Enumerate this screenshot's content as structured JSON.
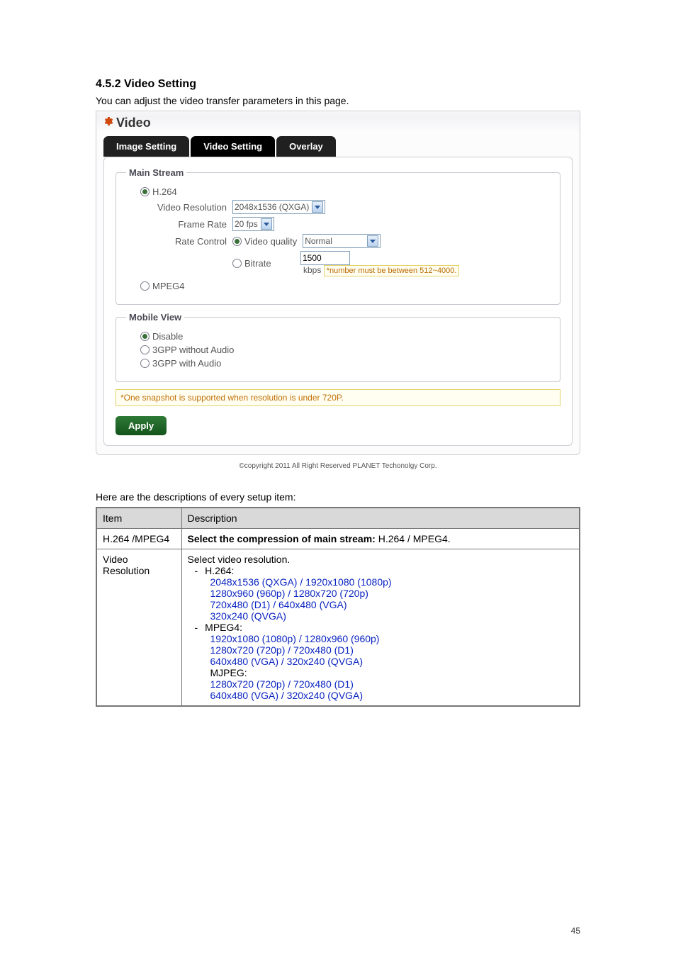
{
  "section": {
    "number": "4.5.2",
    "title": "4.5.2 Video Setting",
    "intro": "You can adjust the video transfer parameters in this page."
  },
  "video_header": "Video",
  "tabs": {
    "image": "Image Setting",
    "video": "Video Setting",
    "overlay": "Overlay"
  },
  "main_stream": {
    "legend": "Main Stream",
    "h264": "H.264",
    "video_resolution_label": "Video Resolution",
    "video_resolution_value": "2048x1536 (QXGA)",
    "frame_rate_label": "Frame Rate",
    "frame_rate_value": "20 fps",
    "rate_control_label": "Rate Control",
    "video_quality_label": "Video quality",
    "video_quality_value": "Normal",
    "bitrate_label": "Bitrate",
    "bitrate_value": "1500",
    "kbps": "kbps",
    "bitrate_note": "*number must be between 512~4000.",
    "mpeg4": "MPEG4"
  },
  "mobile_view": {
    "legend": "Mobile View",
    "disable": "Disable",
    "gpp_no_audio": "3GPP without Audio",
    "gpp_audio": "3GPP with Audio"
  },
  "snapshot_note": "*One snapshot is supported when resolution is under 720P.",
  "apply": "Apply",
  "copyright": "©copyright 2011 All Right Reserved PLANET Techonolgy Corp.",
  "desc_intro": "Here are the descriptions of every setup item:",
  "table": {
    "h_item": "Item",
    "h_desc": "Description",
    "r1_item": "H.264 /MPEG4",
    "r1_desc_prefix": "Select the compression of main stream: ",
    "r1_desc_suffix": "H.264 / MPEG4.",
    "r2_item_a": "Video",
    "r2_item_b": "Resolution",
    "r2_line1": "Select video resolution.",
    "r2_h264": "H.264:",
    "r2_h264_l1": "2048x1536 (QXGA) / 1920x1080 (1080p)",
    "r2_h264_l2": "1280x960 (960p)   / 1280x720 (720p)",
    "r2_h264_l3": "720x480 (D1)      / 640x480 (VGA)",
    "r2_h264_l4": "320x240 (QVGA)",
    "r2_mpeg4": "MPEG4:",
    "r2_mpeg4_l1": "1920x1080 (1080p) / 1280x960 (960p)",
    "r2_mpeg4_l2": "1280x720 (720p)   / 720x480 (D1)",
    "r2_mpeg4_l3": "640x480 (VGA)    / 320x240 (QVGA)",
    "r2_mjpeg": "MJPEG:",
    "r2_mjpeg_l1": "1280x720 (720p) / 720x480 (D1)",
    "r2_mjpeg_l2": "640x480 (VGA)   / 320x240 (QVGA)"
  },
  "page_number": "45"
}
